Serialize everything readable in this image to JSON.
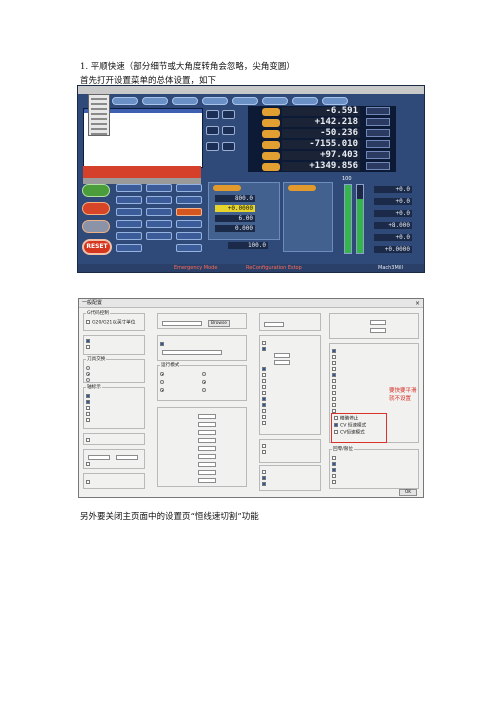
{
  "doc": {
    "heading": "1.  平顺快速（部分细节或大角度转角会忽略，尖角变圆）",
    "intro": "首先打开设置菜单的总体设置，如下",
    "footer": "另外要关闭主页面中的设置页“恒线速切割”功能"
  },
  "mach3": {
    "dro_values": [
      "-6.591",
      "+142.218",
      "-50.236",
      "-7155.010",
      "+97.403",
      "+1349.856"
    ],
    "reset_label": "RESET",
    "status_mode": "Emergency Mode",
    "status_config": "ReConfiguration Estop",
    "status_profile": "Mach3Mill",
    "mid_values": [
      "800.0",
      "+0.0000",
      "6.00",
      "0.000",
      "100.0"
    ],
    "spindle_values": [
      "+0.0",
      "+0.0",
      "+0.0",
      "+8.000",
      "+0.0",
      "+0.0000"
    ],
    "gauge_value": "100"
  },
  "config": {
    "title": "一般配置",
    "close": "×",
    "groups": {
      "gcode": "G代码控制",
      "motion": "运行模式",
      "tool_change": "刀具交换",
      "axis_mode": "轴标示",
      "homing": "回零/限位"
    },
    "items": {
      "g20": "G20/G21以英寸单位",
      "exact_stop": "精确停止",
      "cv": "CV 恒速模式",
      "cv_note": "CV恒速模式"
    },
    "annotation": "要快要平滑就不设置",
    "buttons": {
      "ok": "OK",
      "browse": "Browse"
    }
  }
}
